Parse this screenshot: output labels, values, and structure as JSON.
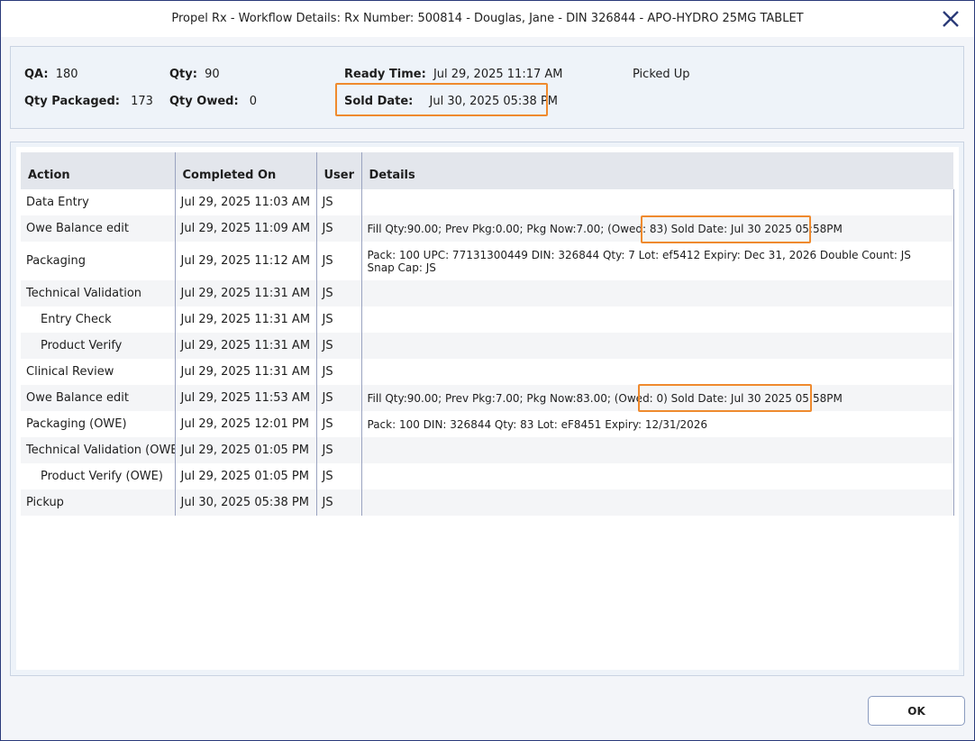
{
  "window": {
    "title": "Propel Rx - Workflow Details: Rx Number: 500814 - Douglas, Jane - DIN 326844 - APO-HYDRO 25MG TABLET",
    "close_icon": "close-icon"
  },
  "summary": {
    "qa_label": "QA:",
    "qa_value": "180",
    "qty_label": "Qty:",
    "qty_value": "90",
    "ready_time_label": "Ready Time:",
    "ready_time_value": "Jul 29, 2025 11:17 AM",
    "status": "Picked Up",
    "qty_packaged_label": "Qty Packaged:",
    "qty_packaged_value": "173",
    "qty_owed_label": "Qty Owed:",
    "qty_owed_value": "0",
    "sold_date_label": "Sold Date:",
    "sold_date_value": "Jul 30, 2025 05:38 PM"
  },
  "table": {
    "headers": [
      "Action",
      "Completed On",
      "User",
      "Details"
    ],
    "rows": [
      {
        "action": "Data Entry",
        "completed": "Jul 29, 2025 11:03 AM",
        "user": "JS",
        "details": ""
      },
      {
        "action": "Owe Balance edit",
        "completed": "Jul 29, 2025 11:09 AM",
        "user": "JS",
        "details": "Fill Qty:90.00; Prev Pkg:0.00; Pkg Now:7.00; (Owed: 83) Sold Date: Jul 30 2025 05:58PM"
      },
      {
        "action": "Packaging",
        "completed": "Jul 29, 2025 11:12 AM",
        "user": "JS",
        "details": "Pack: 100  UPC: 77131300449  DIN: 326844  Qty: 7  Lot: ef5412  Expiry: Dec 31, 2026   Double Count: JS  Snap Cap: JS"
      },
      {
        "action": "Technical Validation",
        "completed": "Jul 29, 2025 11:31 AM",
        "user": "JS",
        "details": ""
      },
      {
        "action": "Entry Check",
        "completed": "Jul 29, 2025 11:31 AM",
        "user": "JS",
        "details": ""
      },
      {
        "action": "Product Verify",
        "completed": "Jul 29, 2025 11:31 AM",
        "user": "JS",
        "details": ""
      },
      {
        "action": "Clinical Review",
        "completed": "Jul 29, 2025 11:31 AM",
        "user": "JS",
        "details": ""
      },
      {
        "action": "Owe Balance edit",
        "completed": "Jul 29, 2025 11:53 AM",
        "user": "JS",
        "details": "Fill Qty:90.00; Prev Pkg:7.00; Pkg Now:83.00; (Owed: 0) Sold Date: Jul 30 2025 05:58PM"
      },
      {
        "action": "Packaging (OWE)",
        "completed": "Jul 29, 2025 12:01 PM",
        "user": "JS",
        "details": "Pack: 100  DIN: 326844  Qty: 83  Lot: eF8451  Expiry: 12/31/2026"
      },
      {
        "action": "Technical Validation (OWE)",
        "completed": "Jul 29, 2025 01:05 PM",
        "user": "JS",
        "details": ""
      },
      {
        "action": "Product Verify (OWE)",
        "completed": "Jul 29, 2025 01:05 PM",
        "user": "JS",
        "details": ""
      },
      {
        "action": "Pickup",
        "completed": "Jul 30, 2025 05:38 PM",
        "user": "JS",
        "details": ""
      }
    ]
  },
  "footer": {
    "ok_label": "OK"
  },
  "colors": {
    "highlight": "#ef8a2e",
    "header_bg": "#e3e6ec",
    "panel_bg": "#eef3f9"
  }
}
